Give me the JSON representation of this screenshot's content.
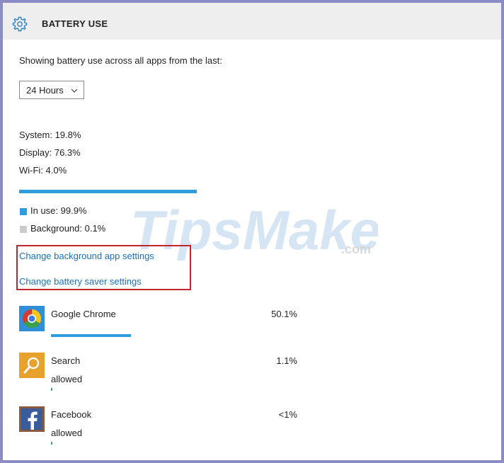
{
  "header": {
    "title": "BATTERY USE",
    "icon": "gear-icon"
  },
  "intro_text": "Showing battery use across all apps from the last:",
  "period_dropdown": {
    "selected": "24 Hours",
    "icon": "chevron-down-icon"
  },
  "usage_breakdown": {
    "items": [
      {
        "label": "System: 19.8%"
      },
      {
        "label": "Display: 76.3%"
      },
      {
        "label": "Wi-Fi: 4.0%"
      }
    ],
    "total_bar_fraction": 1.0
  },
  "legend": {
    "items": [
      {
        "label": "In use: 99.9%",
        "color": "#2e9cdd"
      },
      {
        "label": "Background: 0.1%",
        "color": "#cccccc"
      }
    ]
  },
  "links": {
    "background_apps": "Change background app settings",
    "battery_saver": "Change battery saver settings"
  },
  "watermark": {
    "brand": "TipsMake",
    "suffix": ".com"
  },
  "apps": [
    {
      "name": "Google Chrome",
      "status": "",
      "percent": "50.1%",
      "bar_fraction": 0.5,
      "icon": "chrome-icon"
    },
    {
      "name": "Search",
      "status": "allowed",
      "percent": "1.1%",
      "bar_fraction": 0.011,
      "icon": "search-icon"
    },
    {
      "name": "Facebook",
      "status": "allowed",
      "percent": "<1%",
      "bar_fraction": 0.004,
      "icon": "facebook-icon"
    }
  ],
  "colors": {
    "accent": "#2e9cdd",
    "link": "#1d6fb8",
    "highlight": "#c0262c",
    "header_bg": "#eeeeee",
    "page_border": "#8c8cc4"
  }
}
